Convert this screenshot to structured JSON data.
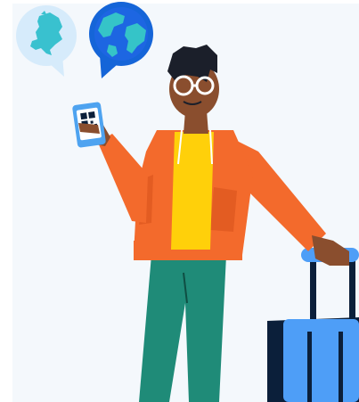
{
  "illustration": {
    "subject": "traveler-with-phone-and-suitcase",
    "icons": [
      "netherlands-map-bubble-icon",
      "globe-bubble-icon",
      "qr-code-icon"
    ]
  },
  "colors": {
    "panel_bg": "#f4f8fc",
    "bubble_light": "#d6ebfb",
    "bubble_blue": "#1565d8",
    "map_teal": "#39c1cf",
    "globe_ocean": "#1d66e2",
    "globe_land": "#35c4c8",
    "skin": "#8a4e2e",
    "hair": "#1b1f2a",
    "hoodie": "#f36a2c",
    "hoodie_shadow": "#d6501b",
    "shirt": "#ffd00a",
    "pants": "#1f8b78",
    "suitcase": "#4e9ef7",
    "suitcase_dark": "#0b1f3a",
    "phone": "#4ea3f0"
  }
}
